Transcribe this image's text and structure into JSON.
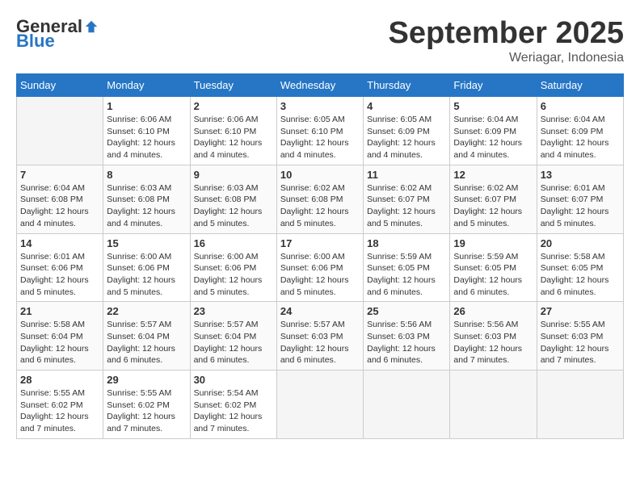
{
  "header": {
    "logo_general": "General",
    "logo_blue": "Blue",
    "month_title": "September 2025",
    "location": "Weriagar, Indonesia"
  },
  "days_of_week": [
    "Sunday",
    "Monday",
    "Tuesday",
    "Wednesday",
    "Thursday",
    "Friday",
    "Saturday"
  ],
  "weeks": [
    [
      {
        "day": "",
        "sunrise": "",
        "sunset": "",
        "daylight": ""
      },
      {
        "day": "1",
        "sunrise": "Sunrise: 6:06 AM",
        "sunset": "Sunset: 6:10 PM",
        "daylight": "Daylight: 12 hours and 4 minutes."
      },
      {
        "day": "2",
        "sunrise": "Sunrise: 6:06 AM",
        "sunset": "Sunset: 6:10 PM",
        "daylight": "Daylight: 12 hours and 4 minutes."
      },
      {
        "day": "3",
        "sunrise": "Sunrise: 6:05 AM",
        "sunset": "Sunset: 6:10 PM",
        "daylight": "Daylight: 12 hours and 4 minutes."
      },
      {
        "day": "4",
        "sunrise": "Sunrise: 6:05 AM",
        "sunset": "Sunset: 6:09 PM",
        "daylight": "Daylight: 12 hours and 4 minutes."
      },
      {
        "day": "5",
        "sunrise": "Sunrise: 6:04 AM",
        "sunset": "Sunset: 6:09 PM",
        "daylight": "Daylight: 12 hours and 4 minutes."
      },
      {
        "day": "6",
        "sunrise": "Sunrise: 6:04 AM",
        "sunset": "Sunset: 6:09 PM",
        "daylight": "Daylight: 12 hours and 4 minutes."
      }
    ],
    [
      {
        "day": "7",
        "sunrise": "Sunrise: 6:04 AM",
        "sunset": "Sunset: 6:08 PM",
        "daylight": "Daylight: 12 hours and 4 minutes."
      },
      {
        "day": "8",
        "sunrise": "Sunrise: 6:03 AM",
        "sunset": "Sunset: 6:08 PM",
        "daylight": "Daylight: 12 hours and 4 minutes."
      },
      {
        "day": "9",
        "sunrise": "Sunrise: 6:03 AM",
        "sunset": "Sunset: 6:08 PM",
        "daylight": "Daylight: 12 hours and 5 minutes."
      },
      {
        "day": "10",
        "sunrise": "Sunrise: 6:02 AM",
        "sunset": "Sunset: 6:08 PM",
        "daylight": "Daylight: 12 hours and 5 minutes."
      },
      {
        "day": "11",
        "sunrise": "Sunrise: 6:02 AM",
        "sunset": "Sunset: 6:07 PM",
        "daylight": "Daylight: 12 hours and 5 minutes."
      },
      {
        "day": "12",
        "sunrise": "Sunrise: 6:02 AM",
        "sunset": "Sunset: 6:07 PM",
        "daylight": "Daylight: 12 hours and 5 minutes."
      },
      {
        "day": "13",
        "sunrise": "Sunrise: 6:01 AM",
        "sunset": "Sunset: 6:07 PM",
        "daylight": "Daylight: 12 hours and 5 minutes."
      }
    ],
    [
      {
        "day": "14",
        "sunrise": "Sunrise: 6:01 AM",
        "sunset": "Sunset: 6:06 PM",
        "daylight": "Daylight: 12 hours and 5 minutes."
      },
      {
        "day": "15",
        "sunrise": "Sunrise: 6:00 AM",
        "sunset": "Sunset: 6:06 PM",
        "daylight": "Daylight: 12 hours and 5 minutes."
      },
      {
        "day": "16",
        "sunrise": "Sunrise: 6:00 AM",
        "sunset": "Sunset: 6:06 PM",
        "daylight": "Daylight: 12 hours and 5 minutes."
      },
      {
        "day": "17",
        "sunrise": "Sunrise: 6:00 AM",
        "sunset": "Sunset: 6:06 PM",
        "daylight": "Daylight: 12 hours and 5 minutes."
      },
      {
        "day": "18",
        "sunrise": "Sunrise: 5:59 AM",
        "sunset": "Sunset: 6:05 PM",
        "daylight": "Daylight: 12 hours and 6 minutes."
      },
      {
        "day": "19",
        "sunrise": "Sunrise: 5:59 AM",
        "sunset": "Sunset: 6:05 PM",
        "daylight": "Daylight: 12 hours and 6 minutes."
      },
      {
        "day": "20",
        "sunrise": "Sunrise: 5:58 AM",
        "sunset": "Sunset: 6:05 PM",
        "daylight": "Daylight: 12 hours and 6 minutes."
      }
    ],
    [
      {
        "day": "21",
        "sunrise": "Sunrise: 5:58 AM",
        "sunset": "Sunset: 6:04 PM",
        "daylight": "Daylight: 12 hours and 6 minutes."
      },
      {
        "day": "22",
        "sunrise": "Sunrise: 5:57 AM",
        "sunset": "Sunset: 6:04 PM",
        "daylight": "Daylight: 12 hours and 6 minutes."
      },
      {
        "day": "23",
        "sunrise": "Sunrise: 5:57 AM",
        "sunset": "Sunset: 6:04 PM",
        "daylight": "Daylight: 12 hours and 6 minutes."
      },
      {
        "day": "24",
        "sunrise": "Sunrise: 5:57 AM",
        "sunset": "Sunset: 6:03 PM",
        "daylight": "Daylight: 12 hours and 6 minutes."
      },
      {
        "day": "25",
        "sunrise": "Sunrise: 5:56 AM",
        "sunset": "Sunset: 6:03 PM",
        "daylight": "Daylight: 12 hours and 6 minutes."
      },
      {
        "day": "26",
        "sunrise": "Sunrise: 5:56 AM",
        "sunset": "Sunset: 6:03 PM",
        "daylight": "Daylight: 12 hours and 7 minutes."
      },
      {
        "day": "27",
        "sunrise": "Sunrise: 5:55 AM",
        "sunset": "Sunset: 6:03 PM",
        "daylight": "Daylight: 12 hours and 7 minutes."
      }
    ],
    [
      {
        "day": "28",
        "sunrise": "Sunrise: 5:55 AM",
        "sunset": "Sunset: 6:02 PM",
        "daylight": "Daylight: 12 hours and 7 minutes."
      },
      {
        "day": "29",
        "sunrise": "Sunrise: 5:55 AM",
        "sunset": "Sunset: 6:02 PM",
        "daylight": "Daylight: 12 hours and 7 minutes."
      },
      {
        "day": "30",
        "sunrise": "Sunrise: 5:54 AM",
        "sunset": "Sunset: 6:02 PM",
        "daylight": "Daylight: 12 hours and 7 minutes."
      },
      {
        "day": "",
        "sunrise": "",
        "sunset": "",
        "daylight": ""
      },
      {
        "day": "",
        "sunrise": "",
        "sunset": "",
        "daylight": ""
      },
      {
        "day": "",
        "sunrise": "",
        "sunset": "",
        "daylight": ""
      },
      {
        "day": "",
        "sunrise": "",
        "sunset": "",
        "daylight": ""
      }
    ]
  ]
}
